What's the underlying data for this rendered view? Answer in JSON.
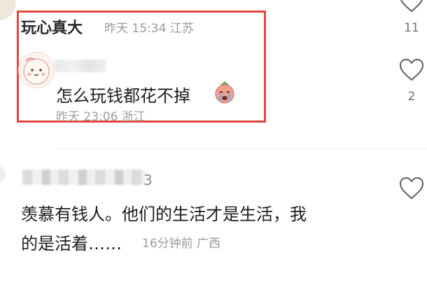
{
  "top_comment": {
    "username": "玩心真大",
    "meta": "昨天 15:34 江苏",
    "like_count": "11"
  },
  "reply": {
    "text": "怎么玩钱都花不掉",
    "meta": "昨天 23:06 浙江",
    "like_count": "2",
    "emoji_icon": "crying-emoji-icon"
  },
  "second_comment": {
    "username_suffix": "3",
    "text_line1": "羡慕有钱人。他们的生活才是生活，我",
    "text_line2": "的是活着……",
    "meta": "16分钟前 广西"
  },
  "colors": {
    "highlight_border": "#e1473f",
    "meta_text": "#9a9a9a",
    "heart_stroke": "#6b6b6b"
  }
}
